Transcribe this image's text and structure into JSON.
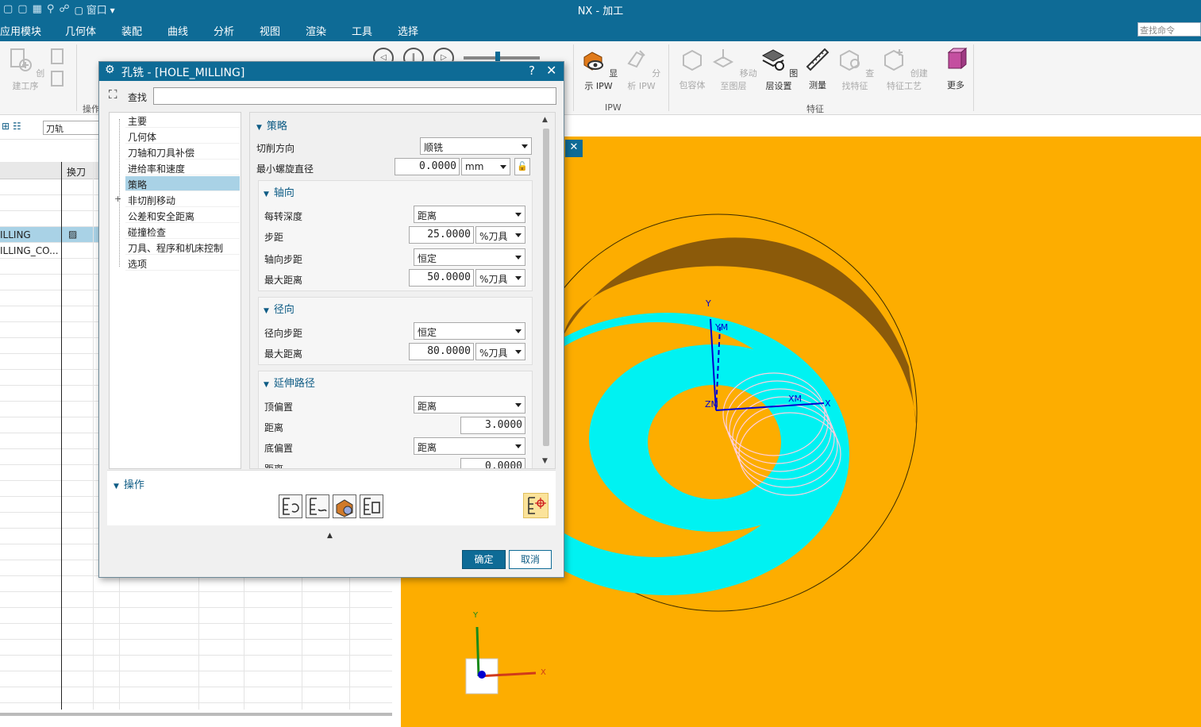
{
  "window": {
    "title": "NX - 加工",
    "window_menu": "窗口"
  },
  "menu": [
    "应用模块",
    "几何体",
    "装配",
    "曲线",
    "分析",
    "视图",
    "渲染",
    "工具",
    "选择"
  ],
  "command_search": {
    "placeholder": "查找命令"
  },
  "ribbon": {
    "create_operation": "创建工序",
    "group_operation": "操作",
    "ipw_buttons": [
      "显示 IPW",
      "分析 IPW"
    ],
    "group_ipw": "IPW",
    "feature_buttons": [
      "包容体",
      "移动至图层",
      "图层设置",
      "测量",
      "查找特征",
      "创建特征工艺",
      "更多"
    ],
    "group_feature": "特征"
  },
  "navigator": {
    "filter_value": "刀轨",
    "column_toolchange": "换刀",
    "rows": [
      "ILLING",
      "ILLING_CO..."
    ]
  },
  "dialog": {
    "title": "孔铣 - [HOLE_MILLING]",
    "help": "?",
    "find_label": "查找",
    "tree": [
      "主要",
      "几何体",
      "刀轴和刀具补偿",
      "进给率和速度",
      "策略",
      "非切削移动",
      "公差和安全距离",
      "碰撞检查",
      "刀具、程序和机床控制",
      "选项"
    ],
    "selected_node": "策略",
    "section_strategy": "策略",
    "cut_direction": {
      "label": "切削方向",
      "value": "顺铣"
    },
    "min_helix_diameter": {
      "label": "最小螺旋直径",
      "value": "0.0000",
      "unit": "mm"
    },
    "axial": {
      "title": "轴向",
      "depth_per_rev": {
        "label": "每转深度",
        "value": "距离"
      },
      "step": {
        "label": "步距",
        "value": "25.0000",
        "unit": "%刀具"
      },
      "axial_step": {
        "label": "轴向步距",
        "value": "恒定"
      },
      "max_distance": {
        "label": "最大距离",
        "value": "50.0000",
        "unit": "%刀具"
      }
    },
    "radial": {
      "title": "径向",
      "radial_step": {
        "label": "径向步距",
        "value": "恒定"
      },
      "max_distance": {
        "label": "最大距离",
        "value": "80.0000",
        "unit": "%刀具"
      }
    },
    "extend": {
      "title": "延伸路径",
      "top_offset": {
        "label": "顶偏置",
        "value": "距离"
      },
      "distance1": {
        "label": "距离",
        "value": "3.0000"
      },
      "bottom_offset": {
        "label": "底偏置",
        "value": "距离"
      },
      "distance2": {
        "label": "距离",
        "value": "0.0000"
      }
    },
    "operations_title": "操作",
    "ok": "确定",
    "cancel": "取消"
  },
  "viewport": {
    "axis_labels": [
      "Y",
      "YM",
      "ZM",
      "XM",
      "X"
    ],
    "triad_labels": [
      "Y",
      "X"
    ]
  },
  "colors": {
    "accent": "#0e6b96",
    "background_part": "#fdad00",
    "toolpath_cyan": "#00f2f2",
    "wall_brown": "#8b5a0a",
    "selection": "#a9d2e6"
  }
}
